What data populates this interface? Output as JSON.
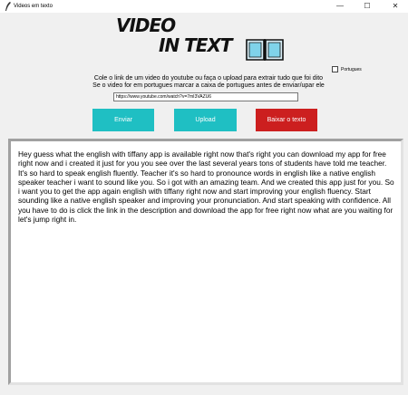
{
  "window": {
    "title": "Videos em texto",
    "icon": "feather-icon",
    "minimize": "—",
    "maximize": "☐",
    "close": "✕"
  },
  "logo": {
    "line1": "VIDEO",
    "line2": "IN TEXT",
    "icon": "book-icon"
  },
  "language_option": {
    "label": "Portugues",
    "checked": false
  },
  "instructions": {
    "line1": "Cole o link de um video do youtube ou faça o upload para extrair tudo que foi dito",
    "line2": "Se o video for em portugues marcar a caixa de portugues antes de enviar/upar ele"
  },
  "url_input": {
    "value": "https://www.youtube.com/watch?v=7mI3VAZU6"
  },
  "buttons": {
    "enviar": "Enviar",
    "upload": "Upload",
    "baixar": "Baixar o texto"
  },
  "colors": {
    "primary_button": "#1fbfc3",
    "danger_button": "#cc1f1f"
  },
  "transcript": {
    "text": "Hey guess what the english with tiffany app is available right now that's right you can download my app for free right now and i created it just for you you see over the last several years tons of students have told me teacher. It's so hard to speak english fluently. Teacher it's so hard to pronounce words in english like a native english speaker teacher i want to sound like you. So i got with an amazing team. And we created this app just for you. So i want you to get the app again english with tiffany right now and start improving your english fluency. Start sounding like a native english speaker and improving your pronunciation. And start speaking with confidence. All you have to do is click the link in the description and download the app for free right now what are you waiting for let's jump right in."
  }
}
